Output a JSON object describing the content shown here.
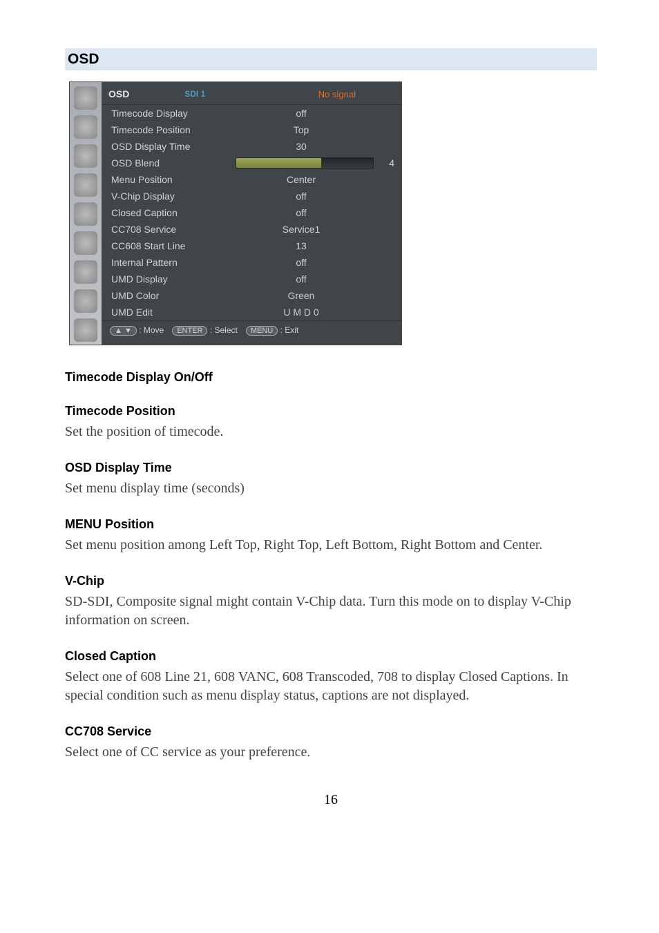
{
  "section_title": "OSD",
  "osd": {
    "header": {
      "title": "OSD",
      "source": "SDI 1",
      "signal": "No signal"
    },
    "rows": [
      {
        "label": "Timecode Display",
        "value": "off"
      },
      {
        "label": "Timecode Position",
        "value": "Top"
      },
      {
        "label": "OSD Display Time",
        "value": "30"
      },
      {
        "label": "OSD Blend",
        "slider_value": "4"
      },
      {
        "label": "Menu Position",
        "value": "Center"
      },
      {
        "label": "V-Chip Display",
        "value": "off"
      },
      {
        "label": "Closed Caption",
        "value": "off"
      },
      {
        "label": "CC708 Service",
        "value": "Service1"
      },
      {
        "label": "CC608 Start Line",
        "value": "13"
      },
      {
        "label": "Internal Pattern",
        "value": "off"
      },
      {
        "label": "UMD Display",
        "value": "off"
      },
      {
        "label": "UMD Color",
        "value": "Green"
      },
      {
        "label": "UMD Edit",
        "value": "U M D  0"
      }
    ],
    "footer": {
      "move_key": "▲ ▼",
      "move_label": ": Move",
      "select_key": "ENTER",
      "select_label": ": Select",
      "exit_key": "MENU",
      "exit_label": ": Exit"
    }
  },
  "sections": {
    "timecode_display": {
      "heading": "Timecode Display On/Off"
    },
    "timecode_position": {
      "heading": "Timecode Position",
      "body": "Set the position of timecode."
    },
    "osd_display_time": {
      "heading": "OSD Display Time",
      "body": "Set menu display time (seconds)"
    },
    "menu_position": {
      "heading": "MENU Position",
      "body": "Set menu position among Left Top, Right Top, Left Bottom, Right Bottom and Center."
    },
    "vchip": {
      "heading": "V-Chip",
      "body": "SD-SDI, Composite signal might contain V-Chip data. Turn this mode on to display V-Chip information on screen."
    },
    "closed_caption": {
      "heading": "Closed Caption",
      "body": "Select one of 608 Line 21, 608 VANC, 608 Transcoded, 708 to display Closed Captions. In special condition such as menu display status, captions are not displayed."
    },
    "cc708_service": {
      "heading": "CC708 Service",
      "body": "Select one of CC service as your preference."
    }
  },
  "page_number": "16"
}
